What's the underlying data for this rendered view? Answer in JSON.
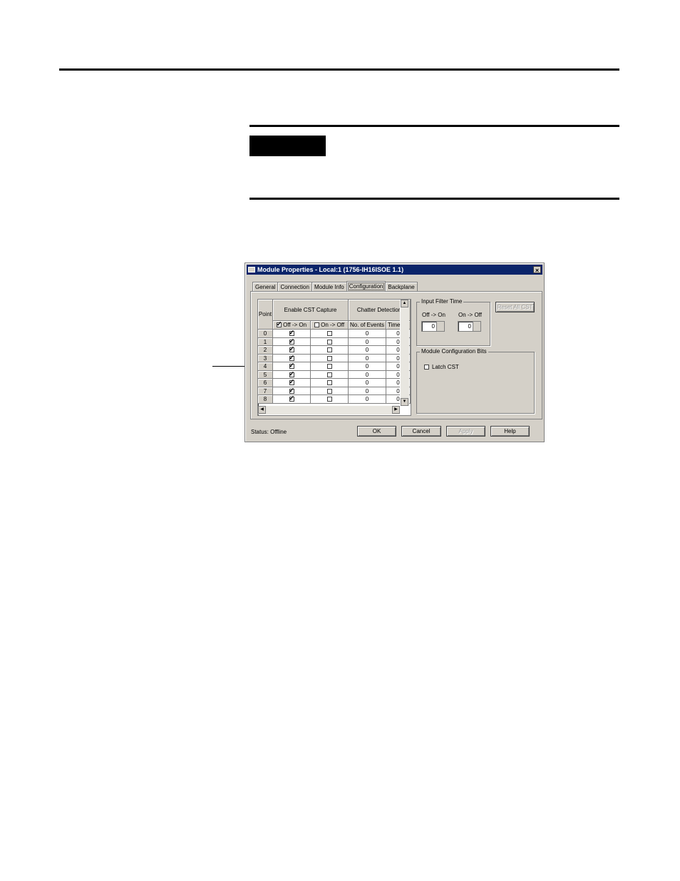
{
  "dialog": {
    "title": "Module Properties - Local:1 (1756-IH16ISOE 1.1)",
    "close_label": "×",
    "tabs": [
      {
        "label": "General"
      },
      {
        "label": "Connection"
      },
      {
        "label": "Module Info"
      },
      {
        "label": "Configuration",
        "active": true
      },
      {
        "label": "Backplane"
      }
    ],
    "grid": {
      "col_point": "Point",
      "col_enable_cst": "Enable CST Capture",
      "col_chatter": "Chatter Detection",
      "sub_off_on": "Off -> On",
      "sub_on_off": "On -> Off",
      "sub_events": "No. of Events",
      "sub_time": "Time",
      "rows": [
        {
          "point": "0",
          "off_on": true,
          "on_off": false,
          "events": "0",
          "time": "0"
        },
        {
          "point": "1",
          "off_on": true,
          "on_off": false,
          "events": "0",
          "time": "0"
        },
        {
          "point": "2",
          "off_on": true,
          "on_off": false,
          "events": "0",
          "time": "0"
        },
        {
          "point": "3",
          "off_on": true,
          "on_off": false,
          "events": "0",
          "time": "0"
        },
        {
          "point": "4",
          "off_on": true,
          "on_off": false,
          "events": "0",
          "time": "0"
        },
        {
          "point": "5",
          "off_on": true,
          "on_off": false,
          "events": "0",
          "time": "0"
        },
        {
          "point": "6",
          "off_on": true,
          "on_off": false,
          "events": "0",
          "time": "0"
        },
        {
          "point": "7",
          "off_on": true,
          "on_off": false,
          "events": "0",
          "time": "0"
        },
        {
          "point": "8",
          "off_on": true,
          "on_off": false,
          "events": "0",
          "time": "0"
        }
      ]
    },
    "input_filter": {
      "title": "Input Filter Time",
      "off_on_label": "Off -> On",
      "on_off_label": "On -> Off",
      "off_on_value": "0",
      "on_off_value": "0"
    },
    "reset_cst_label": "Reset All CST",
    "config_bits": {
      "title": "Module Configuration Bits",
      "latch_cst_label": "Latch CST",
      "latch_cst_checked": false
    },
    "status_text": "Status:  Offline",
    "buttons": {
      "ok": "OK",
      "cancel": "Cancel",
      "apply": "Apply",
      "help": "Help"
    }
  }
}
